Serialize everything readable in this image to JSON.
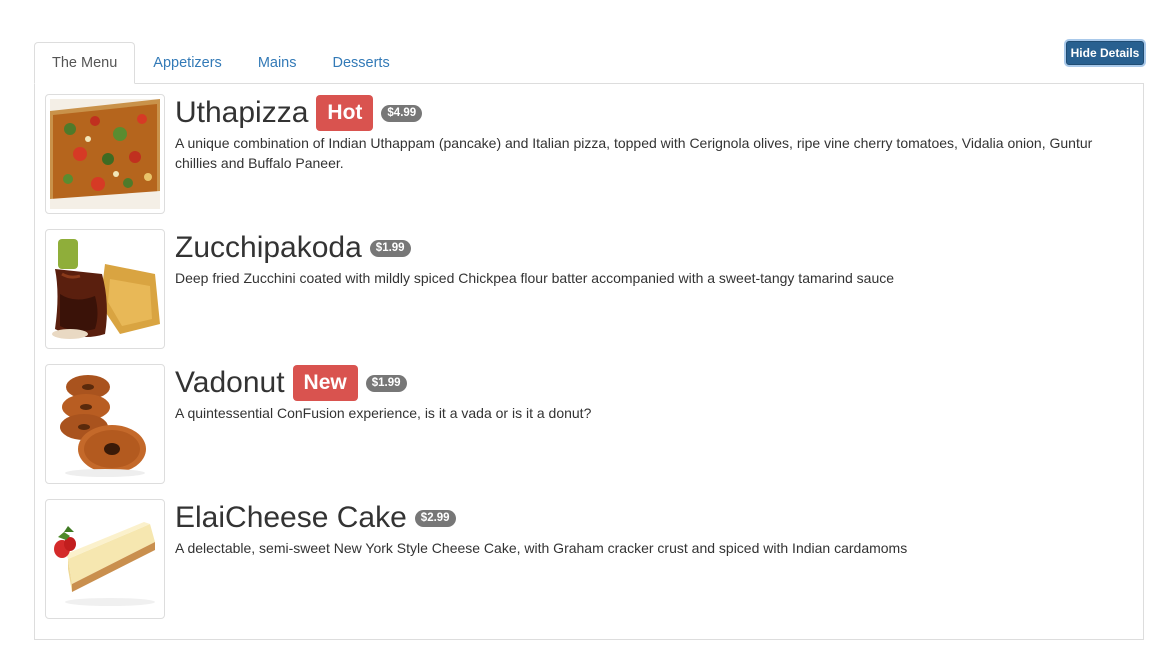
{
  "tabs": [
    {
      "label": "The Menu",
      "active": true
    },
    {
      "label": "Appetizers",
      "active": false
    },
    {
      "label": "Mains",
      "active": false
    },
    {
      "label": "Desserts",
      "active": false
    }
  ],
  "toolbar": {
    "hide_details_label": "Hide Details"
  },
  "colors": {
    "link": "#337ab7",
    "button": "#286090",
    "label_red": "#d9534f",
    "price_badge": "#777777",
    "border": "#dddddd"
  },
  "dishes": [
    {
      "name": "Uthapizza",
      "label": "Hot",
      "price": "$4.99",
      "description": "A unique combination of Indian Uthappam (pancake) and Italian pizza, topped with Cerignola olives, ripe vine cherry tomatoes, Vidalia onion, Guntur chillies and Buffalo Paneer.",
      "image_icon": "pizza-image"
    },
    {
      "name": "Zucchipakoda",
      "label": "",
      "price": "$1.99",
      "description": "Deep fried Zucchini coated with mildly spiced Chickpea flour batter accompanied with a sweet-tangy tamarind sauce",
      "image_icon": "pakoda-image"
    },
    {
      "name": "Vadonut",
      "label": "New",
      "price": "$1.99",
      "description": "A quintessential ConFusion experience, is it a vada or is it a donut?",
      "image_icon": "vadonut-image"
    },
    {
      "name": "ElaiCheese Cake",
      "label": "",
      "price": "$2.99",
      "description": "A delectable, semi-sweet New York Style Cheese Cake, with Graham cracker crust and spiced with Indian cardamoms",
      "image_icon": "cheesecake-image"
    }
  ]
}
